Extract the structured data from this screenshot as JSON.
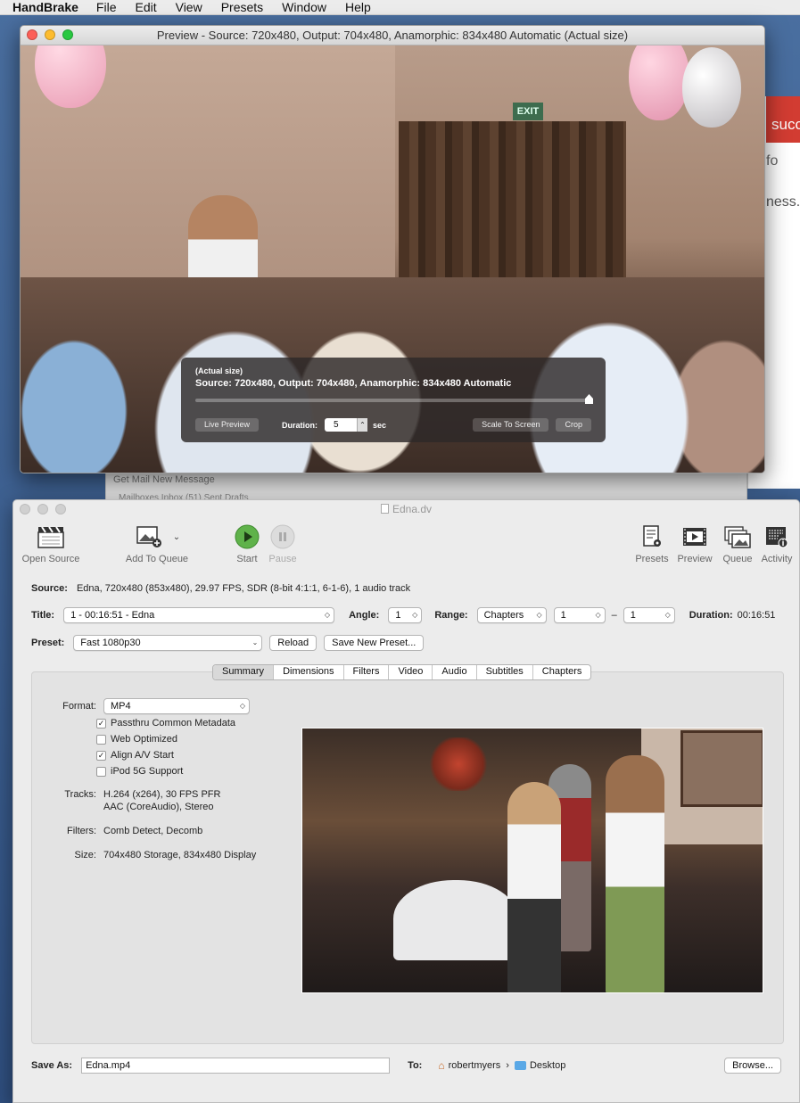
{
  "menubar": {
    "app": "HandBrake",
    "items": [
      "File",
      "Edit",
      "View",
      "Presets",
      "Window",
      "Help"
    ]
  },
  "background": {
    "browser_red_text": "succ",
    "browser_line1": "fo",
    "browser_line2": "ness.c",
    "mail_text": "Get Mail   New Message",
    "mail_text2": "Mailboxes    Inbox (51)    Sent    Drafts"
  },
  "preview_window": {
    "title": "Preview - Source: 720x480, Output: 704x480, Anamorphic: 834x480 Automatic (Actual size)",
    "exit_sign": "EXIT",
    "hud": {
      "size_label": "(Actual size)",
      "info": "Source: 720x480, Output: 704x480, Anamorphic: 834x480 Automatic",
      "live_preview_label": "Live Preview",
      "duration_label": "Duration:",
      "duration_value": "5",
      "duration_unit": "sec",
      "scale_label": "Scale To Screen",
      "crop_label": "Crop"
    }
  },
  "main_window": {
    "title": "Edna.dv",
    "toolbar": {
      "open_source": "Open Source",
      "add_to_queue": "Add To Queue",
      "start": "Start",
      "pause": "Pause",
      "presets": "Presets",
      "preview": "Preview",
      "queue": "Queue",
      "activity": "Activity"
    },
    "source": {
      "label": "Source:",
      "value": "Edna, 720x480 (853x480), 29.97 FPS, SDR (8-bit 4:1:1, 6-1-6), 1 audio track"
    },
    "title_row": {
      "title_label": "Title:",
      "title_value": "1 - 00:16:51 - Edna",
      "angle_label": "Angle:",
      "angle_value": "1",
      "range_label": "Range:",
      "range_value": "Chapters",
      "range_start": "1",
      "range_sep": "–",
      "range_end": "1",
      "duration_label": "Duration:",
      "duration_value": "00:16:51"
    },
    "preset_row": {
      "label": "Preset:",
      "value": "Fast 1080p30",
      "reload_label": "Reload",
      "save_new_label": "Save New Preset..."
    },
    "tabs": [
      "Summary",
      "Dimensions",
      "Filters",
      "Video",
      "Audio",
      "Subtitles",
      "Chapters"
    ],
    "summary": {
      "format_label": "Format:",
      "format_value": "MP4",
      "checkboxes": [
        {
          "label": "Passthru Common Metadata",
          "checked": "✓"
        },
        {
          "label": "Web Optimized",
          "checked": ""
        },
        {
          "label": "Align A/V Start",
          "checked": "✓"
        },
        {
          "label": "iPod 5G Support",
          "checked": ""
        }
      ],
      "tracks_label": "Tracks:",
      "tracks_line1": "H.264 (x264), 30 FPS PFR",
      "tracks_line2": "AAC (CoreAudio), Stereo",
      "filters_label": "Filters:",
      "filters_value": "Comb Detect, Decomb",
      "size_label": "Size:",
      "size_value": "704x480 Storage, 834x480 Display"
    },
    "save": {
      "label": "Save As:",
      "value": "Edna.mp4",
      "to_label": "To:",
      "user_folder": "robertmyers",
      "separator": "›",
      "dest_folder": "Desktop",
      "browse_label": "Browse..."
    }
  }
}
